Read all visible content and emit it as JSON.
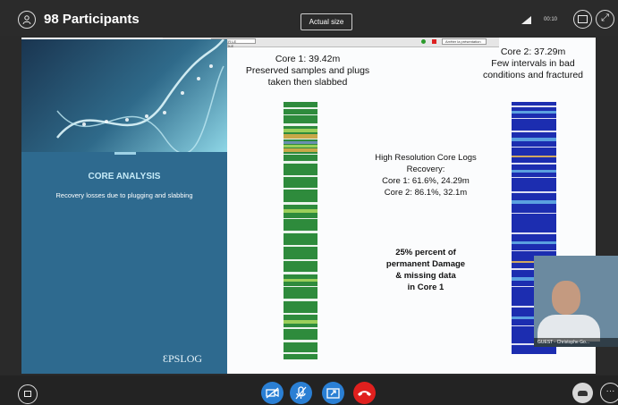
{
  "topbar": {
    "participants_label": "98 Participants",
    "actual_size_label": "Actual size",
    "status_text": "00:10"
  },
  "browser_strip": {
    "left_label": "Presentation en cours",
    "box_label": "ARRÊTER LE CONTRÔLE",
    "button_label": "Arrêter la présentation"
  },
  "slide": {
    "title": "CORE ANALYSIS",
    "subtitle": "Recovery losses due to plugging and slabbing",
    "core1_lines": [
      "Core 1: 39.42m",
      "Preserved samples and plugs",
      "taken then slabbed"
    ],
    "core2_lines": [
      "Core 2: 37.29m",
      "Few intervals in bad",
      "conditions and fractured"
    ],
    "logs_lines": [
      "High Resolution Core Logs",
      "Recovery:",
      "Core 1: 61.6%, 24.29m",
      "Core 2: 86.1%, 32.1m"
    ],
    "damage_lines": [
      "25% percent of",
      "permanent Damage",
      "& missing data",
      "in Core 1"
    ],
    "logo_text": "ƐPSLOG"
  },
  "webcam": {
    "name_label": "GUEST - Christophe Go..."
  },
  "colors": {
    "slide_panel": "#2e6a8f",
    "accent_text": "#c6ebf8",
    "call_button": "#2a7fd4",
    "hangup_button": "#e0201e"
  },
  "icons": {
    "participants": "participants-icon",
    "signal": "signal-icon",
    "layout": "layout-icon",
    "expand": "expand-icon",
    "chat": "chat-icon",
    "video_off": "video-off-icon",
    "mic_off": "mic-off-icon",
    "share": "share-icon",
    "hangup": "hangup-icon",
    "device": "phone-device-icon",
    "more": "more-options-icon"
  }
}
